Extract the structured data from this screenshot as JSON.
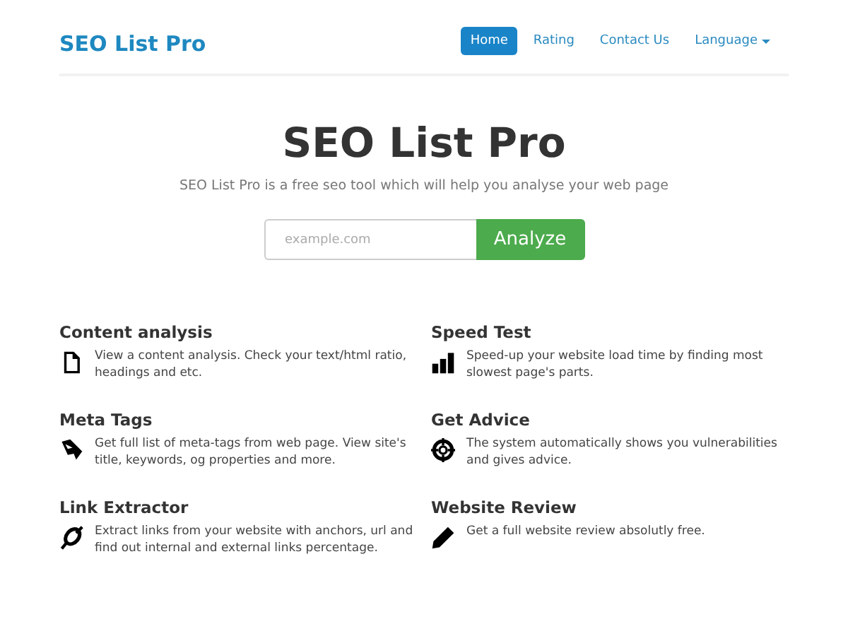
{
  "brand": "SEO List Pro",
  "nav": [
    {
      "label": "Home",
      "selected": true,
      "dropdown": false
    },
    {
      "label": "Rating",
      "selected": false,
      "dropdown": false
    },
    {
      "label": "Contact Us",
      "selected": false,
      "dropdown": false
    },
    {
      "label": "Language",
      "selected": false,
      "dropdown": true
    }
  ],
  "hero": {
    "title": "SEO List Pro",
    "subtitle": "SEO List Pro is a free seo tool which will help you analyse your web page",
    "search": {
      "placeholder": "example.com"
    },
    "button": "Analyze"
  },
  "features": [
    {
      "kind": "document",
      "title": "Content analysis",
      "text": "View a content analysis. Check your text/html ratio, headings and etc."
    },
    {
      "kind": "bars",
      "title": "Speed Test",
      "text": "Speed-up your website load time by finding most slowest page's parts."
    },
    {
      "kind": "tag",
      "title": "Meta Tags",
      "text": "Get full list of meta-tags from web page. View site's title, keywords, og properties and more."
    },
    {
      "kind": "target",
      "title": "Get Advice",
      "text": "The system automatically shows you vulnerabilities and gives advice."
    },
    {
      "kind": "link",
      "title": "Link Extractor",
      "text": "Extract links from your website with anchors, url and find out internal and external links percentage."
    },
    {
      "kind": "pencil",
      "title": "Website Review",
      "text": "Get a full website review absolutly free."
    }
  ]
}
